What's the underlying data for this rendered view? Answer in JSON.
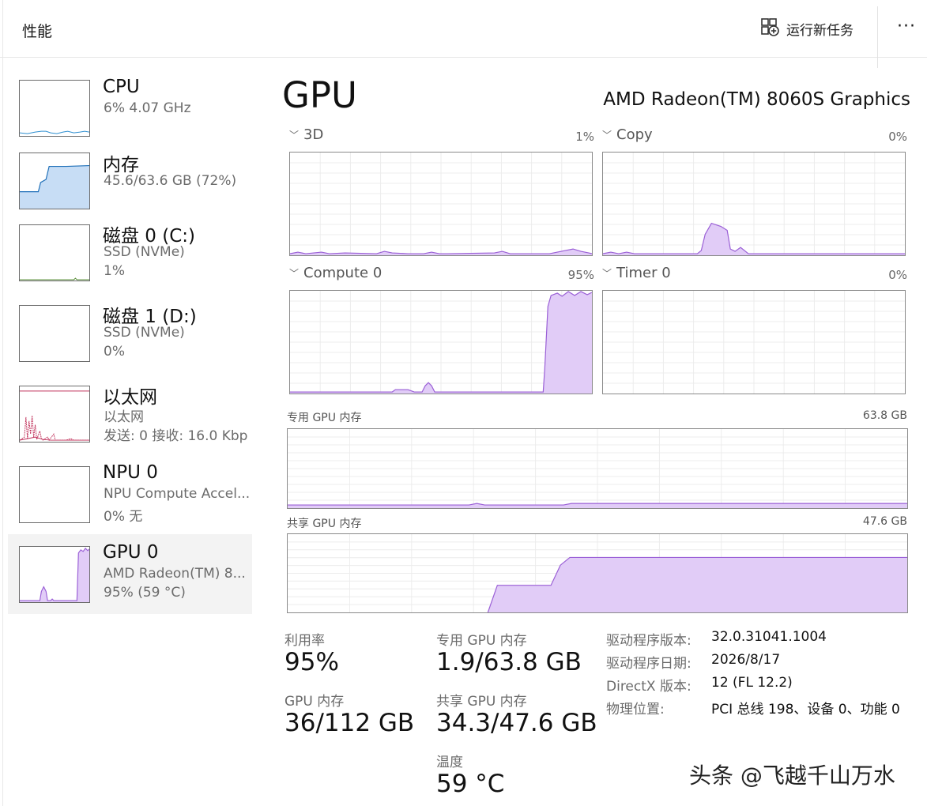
{
  "header": {
    "title": "性能",
    "run_task_label": "运行新任务",
    "more_label": "···"
  },
  "sidebar": {
    "items": [
      {
        "name": "CPU",
        "line1": "6%  4.07 GHz",
        "line2": ""
      },
      {
        "name": "内存",
        "line1": "45.6/63.6 GB (72%)",
        "line2": ""
      },
      {
        "name": "磁盘 0 (C:)",
        "line1": "SSD (NVMe)",
        "line2": "1%"
      },
      {
        "name": "磁盘 1 (D:)",
        "line1": "SSD (NVMe)",
        "line2": "0%"
      },
      {
        "name": "以太网",
        "line1": "以太网",
        "line2": "发送: 0 接收: 16.0 Kbp"
      },
      {
        "name": "NPU 0",
        "line1": "NPU Compute Accel...",
        "line2": "0%  无"
      },
      {
        "name": "GPU 0",
        "line1": "AMD Radeon(TM) 8...",
        "line2": "95%  (59 °C)"
      }
    ]
  },
  "gpu": {
    "title": "GPU",
    "model": "AMD Radeon(TM) 8060S Graphics",
    "engines": [
      {
        "name": "3D",
        "percent": "1%"
      },
      {
        "name": "Copy",
        "percent": "0%"
      },
      {
        "name": "Compute 0",
        "percent": "95%"
      },
      {
        "name": "Timer 0",
        "percent": "0%"
      }
    ],
    "dedicated_mem": {
      "label": "专用 GPU 内存",
      "max": "63.8 GB"
    },
    "shared_mem": {
      "label": "共享 GPU 内存",
      "max": "47.6 GB"
    }
  },
  "stats": {
    "utilization": {
      "label": "利用率",
      "value": "95%"
    },
    "dedicated": {
      "label": "专用 GPU 内存",
      "value": "1.9/63.8 GB"
    },
    "gpu_memory": {
      "label": "GPU 内存",
      "value": "36/112 GB"
    },
    "shared": {
      "label": "共享 GPU 内存",
      "value": "34.3/47.6 GB"
    },
    "temperature": {
      "label": "温度",
      "value": "59 °C"
    }
  },
  "info": {
    "driver_version": {
      "key": "驱动程序版本:",
      "value": "32.0.31041.1004"
    },
    "driver_date": {
      "key": "驱动程序日期:",
      "value": "2026/8/17"
    },
    "directx": {
      "key": "DirectX 版本:",
      "value": "12 (FL 12.2)"
    },
    "location": {
      "key": "物理位置:",
      "value": "PCI 总线 198、设备 0、功能 0"
    }
  },
  "watermark": "头条 @飞越千山万水",
  "colors": {
    "gpu_line": "#9a5fd6",
    "gpu_fill": "#e1ccf7",
    "cpu_line": "#2f8fd0",
    "mem_line": "#1e6fb8",
    "mem_fill": "#c7ddf5",
    "net_line": "#c0305a",
    "grid": "#ececec"
  },
  "icons": {
    "run_task": "run-task-icon",
    "chevron": "chevron-down-icon"
  }
}
